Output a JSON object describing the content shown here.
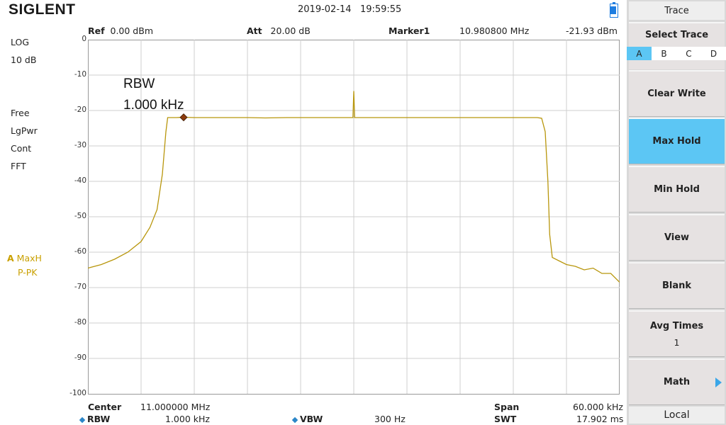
{
  "brand": "SIGLENT",
  "datetime": "2019-02-14   19:59:55",
  "status_left": [
    "LOG",
    "10 dB",
    "Free",
    "LgPwr",
    "Cont",
    "FFT"
  ],
  "trace_indicator": {
    "letter": "A",
    "mode": "MaxH",
    "detector": "P-PK"
  },
  "header": {
    "ref_label": "Ref",
    "ref_value": "0.00 dBm",
    "att_label": "Att",
    "att_value": "20.00 dB",
    "marker_label": "Marker1",
    "marker_freq": "10.980800 MHz",
    "marker_level": "-21.93 dBm"
  },
  "annotation": {
    "line1": "RBW",
    "line2": "1.000 kHz"
  },
  "bottom": {
    "center_label": "Center",
    "center_value": "11.000000 MHz",
    "span_label": "Span",
    "span_value": "60.000 kHz",
    "rbw_label": "RBW",
    "rbw_value": "1.000 kHz",
    "vbw_label": "VBW",
    "vbw_value": "300 Hz",
    "swt_label": "SWT",
    "swt_value": "17.902 ms"
  },
  "panel": {
    "title": "Trace",
    "select_trace_label": "Select Trace",
    "traces": [
      "A",
      "B",
      "C",
      "D"
    ],
    "selected_trace": "A",
    "buttons": [
      {
        "label": "Clear Write",
        "active": false
      },
      {
        "label": "Max Hold",
        "active": true
      },
      {
        "label": "Min Hold",
        "active": false
      },
      {
        "label": "View",
        "active": false
      },
      {
        "label": "Blank",
        "active": false
      },
      {
        "label": "Avg Times",
        "value": "1",
        "active": false
      },
      {
        "label": "Math",
        "active": false,
        "has_submenu": true
      }
    ],
    "footer": "Local"
  },
  "colors": {
    "trace": "#b8960c",
    "marker": "#8b3a0e",
    "active": "#5cc6f4",
    "grid": "#cfcfcf"
  },
  "chart_data": {
    "type": "line",
    "y_ticks": [
      "0",
      "-10",
      "-20",
      "-30",
      "-40",
      "-50",
      "-60",
      "-70",
      "-80",
      "-90",
      "-100"
    ],
    "ylim": [
      -100,
      0
    ],
    "xlim": [
      10.97,
      11.03
    ],
    "x_units": "MHz",
    "grid": true,
    "series": [
      {
        "x": [
          10.97,
          10.9715,
          10.973,
          10.9745,
          10.976,
          10.977,
          10.9778,
          10.9784,
          10.9788,
          10.979,
          10.9792,
          10.98,
          10.9808,
          10.982,
          10.984,
          10.986,
          10.988,
          10.99,
          10.9925,
          10.995,
          10.9975,
          10.9988,
          10.9999,
          11.0,
          11.0001,
          11.0012,
          11.0025,
          11.005,
          11.0075,
          11.01,
          11.0125,
          11.015,
          11.0175,
          11.019,
          11.02,
          11.0207,
          11.0212,
          11.0216,
          11.0219,
          11.0221,
          11.0224,
          11.0232,
          11.024,
          11.025,
          11.026,
          11.027,
          11.028,
          11.029,
          11.03
        ],
        "y": [
          -64.5,
          -63.5,
          -62,
          -60,
          -57,
          -53,
          -48,
          -38,
          -26,
          -22,
          -22,
          -22,
          -21.9,
          -22,
          -22,
          -22,
          -22,
          -22.1,
          -22,
          -22,
          -22,
          -22,
          -22,
          -14.5,
          -22,
          -22,
          -22,
          -22,
          -22,
          -22,
          -22,
          -22,
          -22,
          -22,
          -22,
          -22,
          -22.2,
          -26,
          -40,
          -55,
          -61.5,
          -62.5,
          -63.5,
          -64,
          -65,
          -64.5,
          -66,
          -66,
          -68.5
        ]
      }
    ],
    "marker": {
      "x": 10.9808,
      "y": -21.93
    }
  }
}
